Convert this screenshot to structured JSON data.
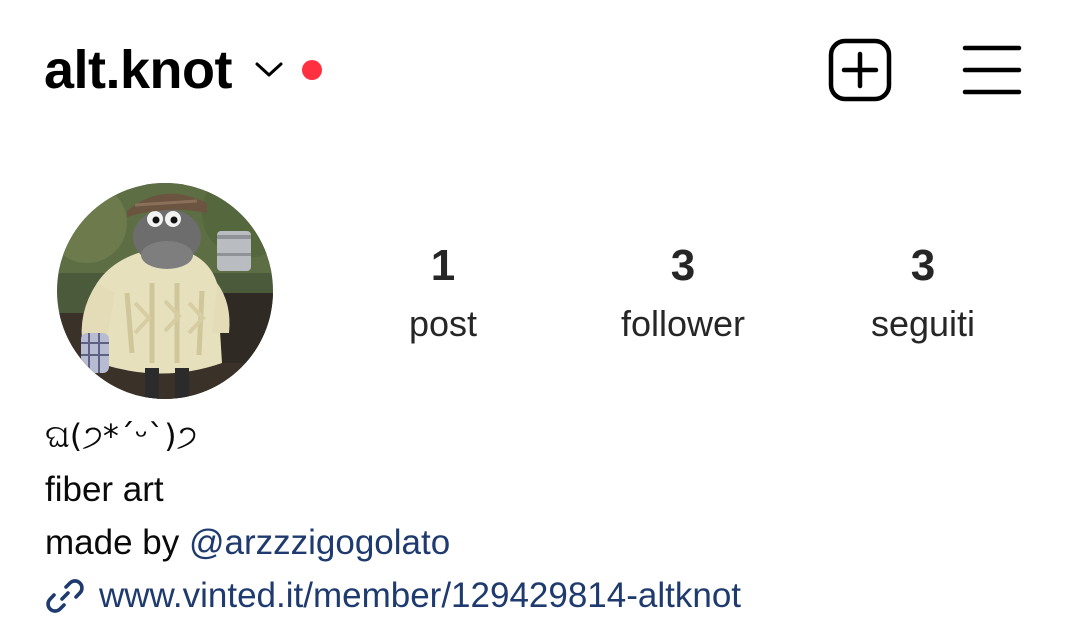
{
  "header": {
    "username": "alt.knot",
    "account_switch_icon": "chevron-down-icon",
    "notification_dot_color": "#ff3040",
    "create_icon": "plus-square-icon",
    "menu_icon": "hamburger-menu-icon"
  },
  "profile": {
    "avatar": "profile-photo"
  },
  "stats": {
    "posts": {
      "value": "1",
      "label": "post"
    },
    "followers": {
      "value": "3",
      "label": "follower"
    },
    "following": {
      "value": "3",
      "label": "seguiti"
    }
  },
  "bio": {
    "line1": "ଘ(੭*ˊᵕˋ)੭",
    "line2": "fiber art",
    "line3_prefix": "made by ",
    "line3_mention": "@arzzzigogolato",
    "link_icon": "link-icon",
    "link": "www.vinted.it/member/129429814-altknot"
  },
  "colors": {
    "link": "#1e3a6e",
    "text": "#000000",
    "background": "#ffffff"
  }
}
